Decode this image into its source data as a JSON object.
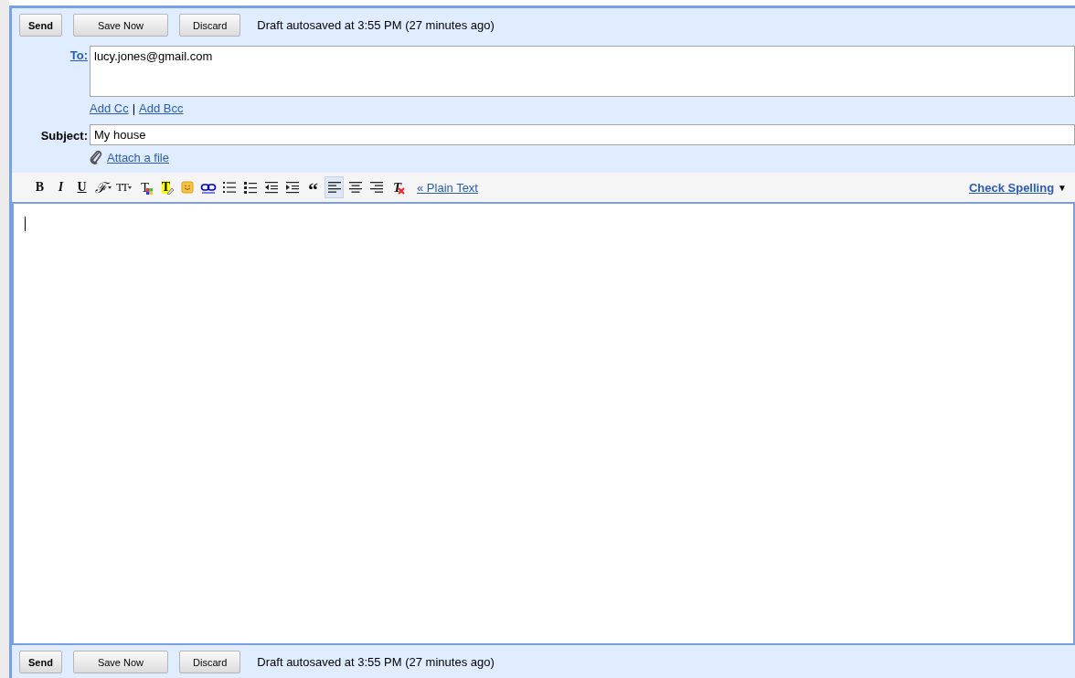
{
  "top_bar": {
    "buttons": [
      {
        "label": "Send",
        "kind": "primary"
      },
      {
        "label": "Save Now",
        "kind": "normal"
      },
      {
        "label": "Discard",
        "kind": "normal"
      }
    ],
    "status": "Draft autosaved at 3:55 PM (27 minutes ago)"
  },
  "to": {
    "label": "To:",
    "value": "lucy.jones@gmail.com"
  },
  "cc_links": [
    "Add Cc",
    "Add Bcc"
  ],
  "cc_separator": "|",
  "subject": {
    "label": "Subject:",
    "value": "My house"
  },
  "attach": "Attach a file",
  "toolbar": [
    {
      "kind": "bold",
      "label": "B",
      "selected": false
    },
    {
      "kind": "italic",
      "label": "I",
      "selected": false
    },
    {
      "kind": "underline",
      "label": "U",
      "selected": false
    },
    {
      "kind": "font",
      "label": "ℱ",
      "selected": false
    },
    {
      "kind": "size",
      "label": "TT",
      "selected": false
    },
    {
      "kind": "textcolor",
      "label": "T",
      "selected": false
    },
    {
      "kind": "highlight",
      "label": "T",
      "selected": false
    },
    {
      "kind": "emoji",
      "selected": false
    },
    {
      "kind": "link",
      "selected": false
    },
    {
      "kind": "numbered",
      "selected": false
    },
    {
      "kind": "bulleted",
      "selected": false
    },
    {
      "kind": "outdent",
      "selected": false
    },
    {
      "kind": "indent",
      "selected": false
    },
    {
      "kind": "quote",
      "label": "“",
      "selected": false
    },
    {
      "kind": "align-left",
      "selected": true
    },
    {
      "kind": "align-center",
      "selected": false
    },
    {
      "kind": "align-right",
      "selected": false
    },
    {
      "kind": "clear",
      "label": "T",
      "selected": false
    }
  ],
  "plain_text_link": "« Plain Text",
  "check_spelling": {
    "label": "Check Spelling",
    "caret": "▼"
  },
  "bottom_bar": {
    "buttons": [
      {
        "label": "Send",
        "kind": "primary"
      },
      {
        "label": "Save Now",
        "kind": "normal"
      },
      {
        "label": "Discard",
        "kind": "normal"
      }
    ],
    "status": "Draft autosaved at 3:55 PM (27 minutes ago)"
  }
}
